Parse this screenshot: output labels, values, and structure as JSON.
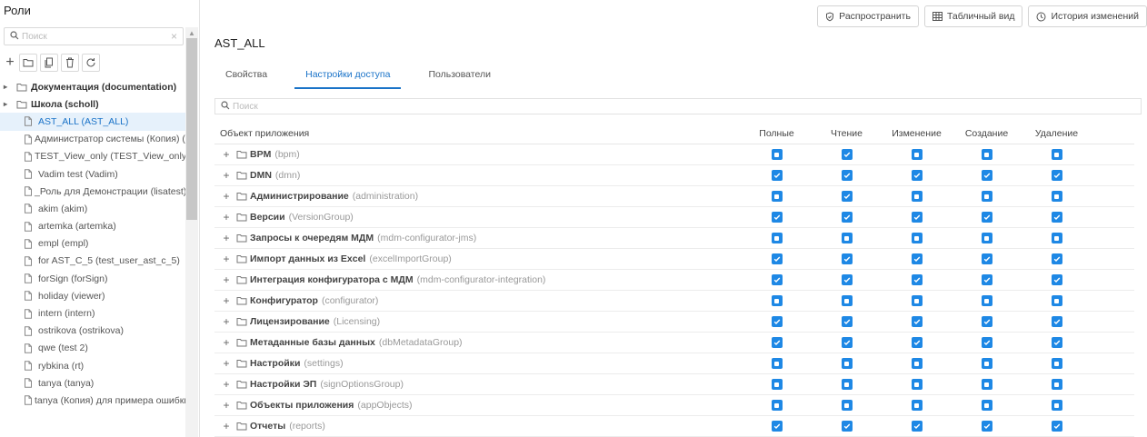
{
  "roles_panel": {
    "title": "Роли",
    "search_placeholder": "Поиск",
    "tree": [
      {
        "label": "Документация (documentation)",
        "type": "group"
      },
      {
        "label": "Школа (scholl)",
        "type": "group"
      },
      {
        "label": "AST_ALL (AST_ALL)",
        "type": "role",
        "selected": true
      },
      {
        "label": "Администратор системы (Копия) (admin_copy)",
        "type": "role"
      },
      {
        "label": "TEST_View_only (TEST_View_only)",
        "type": "role"
      },
      {
        "label": "Vadim test (Vadim)",
        "type": "role"
      },
      {
        "label": "_Роль для Демонстрации (lisatest)",
        "type": "role"
      },
      {
        "label": "akim (akim)",
        "type": "role"
      },
      {
        "label": "artemka (artemka)",
        "type": "role"
      },
      {
        "label": "empl (empl)",
        "type": "role"
      },
      {
        "label": "for AST_C_5 (test_user_ast_c_5)",
        "type": "role"
      },
      {
        "label": "forSign (forSign)",
        "type": "role"
      },
      {
        "label": "holiday (viewer)",
        "type": "role"
      },
      {
        "label": "intern (intern)",
        "type": "role"
      },
      {
        "label": "ostrikova (ostrikova)",
        "type": "role"
      },
      {
        "label": "qwe (test 2)",
        "type": "role"
      },
      {
        "label": "rybkina (rt)",
        "type": "role"
      },
      {
        "label": "tanya (tanya)",
        "type": "role"
      },
      {
        "label": "tanya (Копия) для примера ошибки",
        "type": "role"
      }
    ]
  },
  "toolbar": {
    "distribute_label": "Распространить",
    "table_view_label": "Табличный вид",
    "history_label": "История изменений"
  },
  "role_title": "AST_ALL",
  "tabs": [
    "Свойства",
    "Настройки доступа",
    "Пользователи"
  ],
  "active_tab": 1,
  "access_search_placeholder": "Поиск",
  "columns": [
    "Объект приложения",
    "Полные",
    "Чтение",
    "Изменение",
    "Создание",
    "Удаление"
  ],
  "rows": [
    {
      "name": "BPM",
      "code": "(bpm)",
      "perms": [
        "partial",
        "checked",
        "partial",
        "partial",
        "partial"
      ]
    },
    {
      "name": "DMN",
      "code": "(dmn)",
      "perms": [
        "checked",
        "checked",
        "checked",
        "checked",
        "checked"
      ]
    },
    {
      "name": "Администрирование",
      "code": "(administration)",
      "perms": [
        "partial",
        "checked",
        "partial",
        "partial",
        "partial"
      ]
    },
    {
      "name": "Версии",
      "code": "(VersionGroup)",
      "perms": [
        "checked",
        "checked",
        "checked",
        "checked",
        "checked"
      ]
    },
    {
      "name": "Запросы к очередям МДМ",
      "code": "(mdm-configurator-jms)",
      "perms": [
        "partial",
        "partial",
        "partial",
        "partial",
        "partial"
      ]
    },
    {
      "name": "Импорт данных из Excel",
      "code": "(excelImportGroup)",
      "perms": [
        "checked",
        "checked",
        "checked",
        "checked",
        "checked"
      ]
    },
    {
      "name": "Интеграция конфигуратора с МДМ",
      "code": "(mdm-configurator-integration)",
      "perms": [
        "checked",
        "checked",
        "checked",
        "checked",
        "checked"
      ]
    },
    {
      "name": "Конфигуратор",
      "code": "(configurator)",
      "perms": [
        "partial",
        "partial",
        "partial",
        "partial",
        "partial"
      ]
    },
    {
      "name": "Лицензирование",
      "code": "(Licensing)",
      "perms": [
        "checked",
        "checked",
        "checked",
        "checked",
        "checked"
      ]
    },
    {
      "name": "Метаданные базы данных",
      "code": "(dbMetadataGroup)",
      "perms": [
        "checked",
        "checked",
        "checked",
        "checked",
        "checked"
      ]
    },
    {
      "name": "Настройки",
      "code": "(settings)",
      "perms": [
        "partial",
        "partial",
        "partial",
        "partial",
        "partial"
      ]
    },
    {
      "name": "Настройки ЭП",
      "code": "(signOptionsGroup)",
      "perms": [
        "partial",
        "partial",
        "partial",
        "partial",
        "partial"
      ]
    },
    {
      "name": "Объекты приложения",
      "code": "(appObjects)",
      "perms": [
        "partial",
        "partial",
        "partial",
        "partial",
        "partial"
      ]
    },
    {
      "name": "Отчеты",
      "code": "(reports)",
      "perms": [
        "checked",
        "checked",
        "checked",
        "checked",
        "checked"
      ]
    }
  ],
  "colors": {
    "accent": "#1e88e5",
    "selected_row_bg": "#e6f1fb"
  }
}
